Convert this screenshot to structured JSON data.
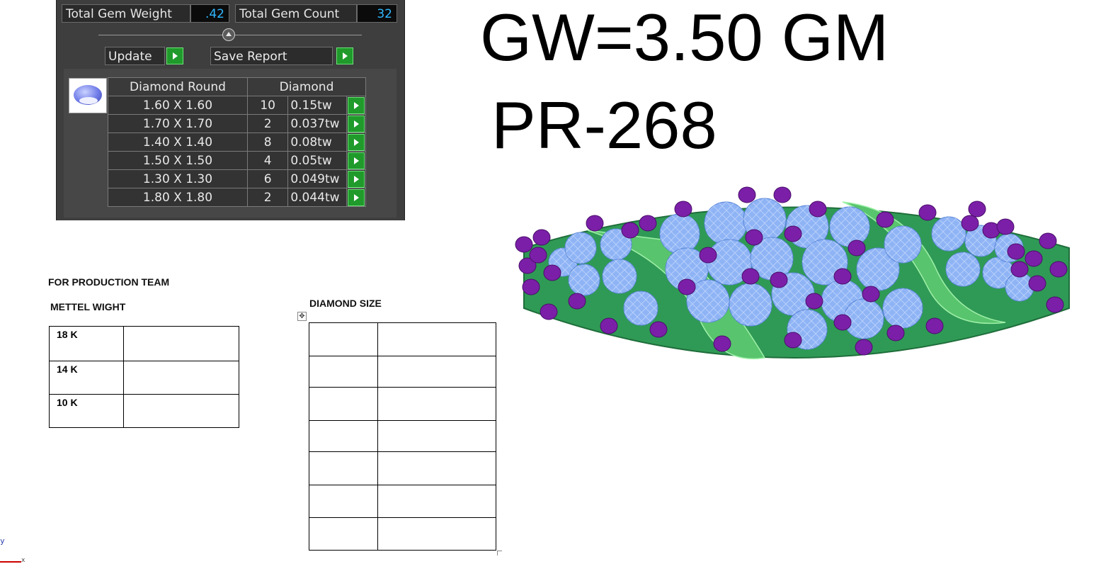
{
  "gem_panel": {
    "total_gem_weight_label": "Total Gem Weight",
    "total_gem_weight_value": ".42",
    "total_gem_count_label": "Total Gem Count",
    "total_gem_count_value": "32",
    "update_label": "Update",
    "save_report_label": "Save Report",
    "table_header": {
      "shape": "Diamond Round",
      "type": "Diamond"
    },
    "rows": [
      {
        "size": "1.60 X 1.60",
        "count": "10",
        "weight": "0.15tw"
      },
      {
        "size": "1.70 X 1.70",
        "count": "2",
        "weight": "0.037tw"
      },
      {
        "size": "1.40 X 1.40",
        "count": "8",
        "weight": "0.08tw"
      },
      {
        "size": "1.50 X 1.50",
        "count": "4",
        "weight": "0.05tw"
      },
      {
        "size": "1.30 X 1.30",
        "count": "6",
        "weight": "0.049tw"
      },
      {
        "size": "1.80 X 1.80",
        "count": "2",
        "weight": "0.044tw"
      }
    ]
  },
  "headings": {
    "gross_weight": "GW=3.50 GM",
    "product_code": "PR-268"
  },
  "production": {
    "team_label": "FOR PRODUCTION TEAM",
    "metal_weight_label": "METTEL WIGHT",
    "metal_rows": [
      {
        "karat": "18 K",
        "value": ""
      },
      {
        "karat": "14 K",
        "value": ""
      },
      {
        "karat": "10 K",
        "value": ""
      }
    ],
    "diamond_size_label": "DIAMOND SIZE",
    "diamond_size_rows": 7
  },
  "axis": {
    "y_label": "y",
    "x_label": "x"
  },
  "colors": {
    "panel_bg": "#3e3e3e",
    "value_text": "#2fb8ff",
    "go_button": "#1f9a2b",
    "ring_band": "#2f9a55",
    "gem_stone": "#8fb4f5",
    "prong": "#7b1fa8"
  }
}
